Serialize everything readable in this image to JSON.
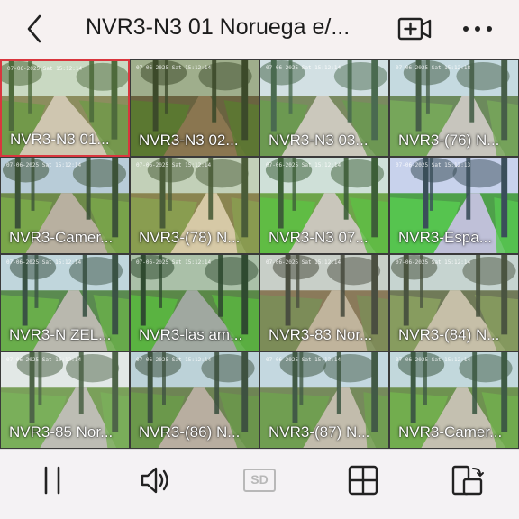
{
  "header": {
    "title": "NVR3-N3 01 Noruega e/...",
    "back_icon": "chevron-left-icon",
    "record_icon": "video-add-icon",
    "more_icon": "more-horizontal-icon"
  },
  "cameras": [
    {
      "label": "NVR3-N3 01...",
      "timestamp": "07-06-2025 Sat 15:12:14",
      "selected": true
    },
    {
      "label": "NVR3-N3 02...",
      "timestamp": "07-06-2025 Sat 15:12:14",
      "selected": false
    },
    {
      "label": "NVR3-N3 03...",
      "timestamp": "07-06-2025 Sat 15:12:14",
      "selected": false
    },
    {
      "label": "NVR3-(76) N...",
      "timestamp": "07-06-2025 Sat 15:12:18",
      "selected": false
    },
    {
      "label": "NVR3-Camer...",
      "timestamp": "07-06-2025 Sat 15:12:14",
      "selected": false
    },
    {
      "label": "NVR3-(78) N...",
      "timestamp": "07-06-2025 Sat 15:12:14",
      "selected": false
    },
    {
      "label": "NVR3-N3 07...",
      "timestamp": "07-06-2025 Sat 15:12:14",
      "selected": false
    },
    {
      "label": "NVR3-Espa...",
      "timestamp": "07-06-2025 Sat 15:12:13",
      "selected": false
    },
    {
      "label": "NVR3-N ZEL...",
      "timestamp": "07-06-2025 Sat 15:12:14",
      "selected": false
    },
    {
      "label": "NVR3-las am...",
      "timestamp": "07-06-2025 Sat 15:12:14",
      "selected": false
    },
    {
      "label": "NVR3-83 Nor...",
      "timestamp": "07-06-2025 Sat 15:12:14",
      "selected": false
    },
    {
      "label": "NVR3-(84) N...",
      "timestamp": "07-06-2025 Sat 15:12:14",
      "selected": false
    },
    {
      "label": "NVR3-85 Nor...",
      "timestamp": "07-06-2025 Sat 15:12:14",
      "selected": false
    },
    {
      "label": "NVR3-(86) N...",
      "timestamp": "07-06-2025 Sat 15:12:14",
      "selected": false
    },
    {
      "label": "NVR3-(87) N...",
      "timestamp": "07-06-2025 Sat 15:12:14",
      "selected": false
    },
    {
      "label": "NVR3-Camer...",
      "timestamp": "07-06-2025 Sat 15:12:14",
      "selected": false
    }
  ],
  "toolbar": {
    "pause_icon": "pause-icon",
    "sound_icon": "speaker-icon",
    "quality_label": "SD",
    "layout_icon": "grid-layout-icon",
    "device_icon": "phone-rotate-icon"
  },
  "colors": {
    "selected_border": "#d9363e",
    "text": "#1c1c1c"
  }
}
